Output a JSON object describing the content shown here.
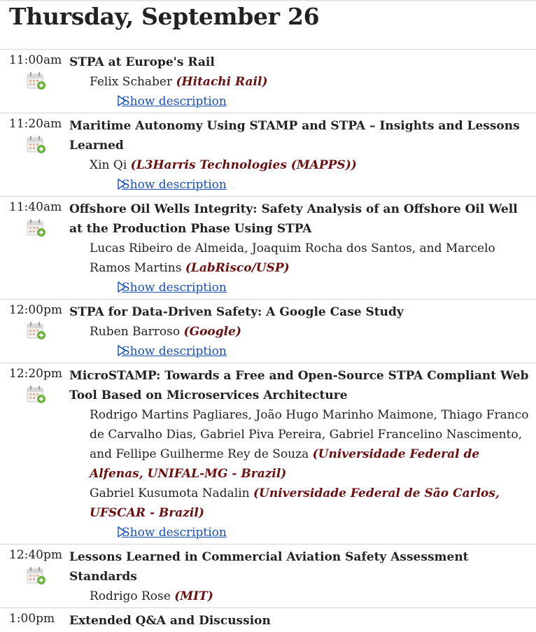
{
  "page_title": "Thursday, September 26",
  "colors": {
    "affiliation": "#6b0f0f",
    "link": "#1a4fb5",
    "divider": "#d3d3d3"
  },
  "sessions": [
    {
      "time": "11:00am",
      "title": "STPA at Europe's Rail",
      "speakers": [
        {
          "names": "Felix Schaber ",
          "affiliation": "(Hitachi Rail)"
        }
      ],
      "link": "Show description"
    },
    {
      "time": "11:20am",
      "title": "Maritime Autonomy Using STAMP and STPA – Insights and Lessons Learned",
      "speakers": [
        {
          "names": "Xin Qi ",
          "affiliation": "(L3Harris Technologies (MAPPS))"
        }
      ],
      "link": "Show description"
    },
    {
      "time": "11:40am",
      "title": "Offshore Oil Wells Integrity: Safety Analysis of an Offshore Oil Well at the Production Phase Using STPA",
      "speakers": [
        {
          "names": "Lucas Ribeiro de Almeida, Joaquim Rocha dos Santos, and Marcelo Ramos Martins ",
          "affiliation": "(LabRisco/USP)"
        }
      ],
      "link": "Show description"
    },
    {
      "time": "12:00pm",
      "title": "STPA for Data-Driven Safety: A Google Case Study",
      "speakers": [
        {
          "names": "Ruben Barroso ",
          "affiliation": "(Google)"
        }
      ],
      "link": "Show description"
    },
    {
      "time": "12:20pm",
      "title": "MicroSTAMP: Towards a Free and Open-Source STPA Compliant Web Tool Based on Microservices Architecture",
      "speakers": [
        {
          "names": "Rodrigo Martins Pagliares, João Hugo Marinho Maimone, Thiago Franco de Carvalho Dias, Gabriel Piva Pereira, Gabriel Francelino Nascimento, and Fellipe Guilherme Rey de Souza ",
          "affiliation": "(Universidade Federal de Alfenas, UNIFAL-MG - Brazil)"
        },
        {
          "names": "Gabriel Kusumota Nadalin ",
          "affiliation": "(Universidade Federal de São Carlos, UFSCAR - Brazil)"
        }
      ],
      "link": "Show description"
    },
    {
      "time": "12:40pm",
      "title": "Lessons Learned in Commercial Aviation Safety Assessment Standards",
      "speakers": [
        {
          "names": "Rodrigo Rose ",
          "affiliation": "(MIT)"
        }
      ],
      "link": ""
    },
    {
      "time": "1:00pm",
      "title": "Extended Q&A and Discussion",
      "speakers": [],
      "link": ""
    }
  ]
}
